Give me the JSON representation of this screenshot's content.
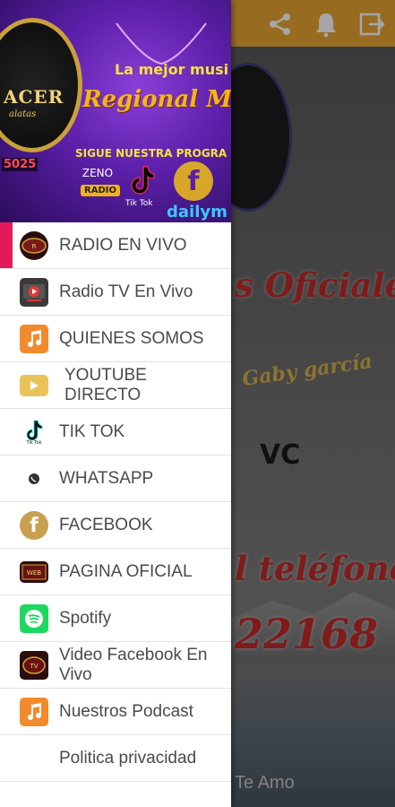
{
  "background": {
    "headline_1": "s Oficiales",
    "signature": "Gaby garcía",
    "logo_mark": "VC",
    "headline_2": "l teléfono",
    "phone_fragment": "22168",
    "footer_text": "Te Amo",
    "toolbar_icons": [
      "share-icon",
      "bell-icon",
      "logout-icon"
    ],
    "toolbar_color": "#e9a633"
  },
  "drawer": {
    "header": {
      "logo_text": "ACER",
      "logo_subtext": "alatas",
      "phone": "5025",
      "tagline_1": "La mejor musi",
      "tagline_2": "Regional Me",
      "tagline_3": "SIGUE NUESTRA PROGRA",
      "zeno": "ZENO",
      "zeno_radio": "RADIO",
      "tiktok_label": "Tik Tok",
      "dailymotion": "dailym"
    },
    "accent_color": "#e4195a",
    "items": [
      {
        "label": "RADIO EN VIVO",
        "icon": "radio-logo-icon",
        "active": true
      },
      {
        "label": "Radio TV En Vivo",
        "icon": "tv-play-icon",
        "active": false
      },
      {
        "label": "QUIENES SOMOS",
        "icon": "music-note-icon",
        "active": false
      },
      {
        "label": "YOUTUBE DIRECTO",
        "icon": "youtube-play-icon",
        "active": false
      },
      {
        "label": "TIK TOK",
        "icon": "tiktok-icon",
        "active": false
      },
      {
        "label": "WHATSAPP",
        "icon": "whatsapp-icon",
        "active": false
      },
      {
        "label": "FACEBOOK",
        "icon": "facebook-icon",
        "active": false
      },
      {
        "label": "PAGINA OFICIAL",
        "icon": "website-logo-icon",
        "active": false
      },
      {
        "label": "Spotify",
        "icon": "spotify-icon",
        "active": false
      },
      {
        "label": "Video Facebook En Vivo",
        "icon": "video-logo-icon",
        "active": false
      },
      {
        "label": "Nuestros Podcast",
        "icon": "podcast-note-icon",
        "active": false
      },
      {
        "label": "Politica privacidad",
        "icon": "",
        "active": false
      }
    ]
  }
}
